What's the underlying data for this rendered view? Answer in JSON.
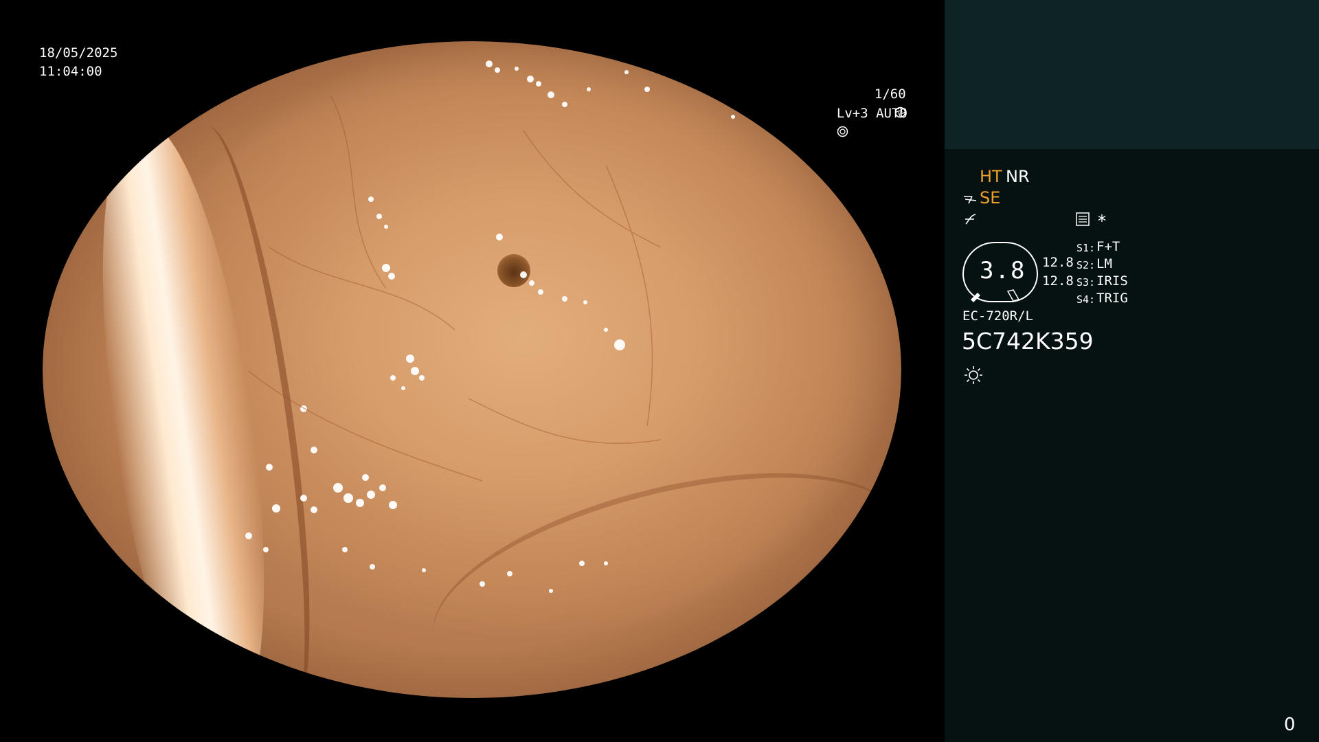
{
  "overlay": {
    "date": "18/05/2025",
    "time": "11:04:00",
    "shutter": "1/60",
    "iris": "Lv+3 AUTO"
  },
  "panel": {
    "ht": "HT",
    "nr": "NR",
    "se": "SE",
    "star": "*",
    "gauge_value": "3.8",
    "val1": "12.8",
    "val2": "12.8",
    "s1_key": "S1:",
    "s1_val": "F+T",
    "s2_key": "S2:",
    "s2_val": "LM",
    "s3_key": "S3:",
    "s3_val": "IRIS",
    "s4_key": "S4:",
    "s4_val": "TRIG",
    "model": "EC-720R/L",
    "serial": "5C742K359",
    "counter": "0"
  },
  "colors": {
    "panel_top": "#0e2323",
    "panel_bg": "#051211",
    "accent_orange": "#f0a02a"
  },
  "icons": [
    "shutter-icon",
    "iris-icon",
    "se-hand-icon",
    "enhance-icon",
    "memo-icon",
    "light-icon"
  ]
}
